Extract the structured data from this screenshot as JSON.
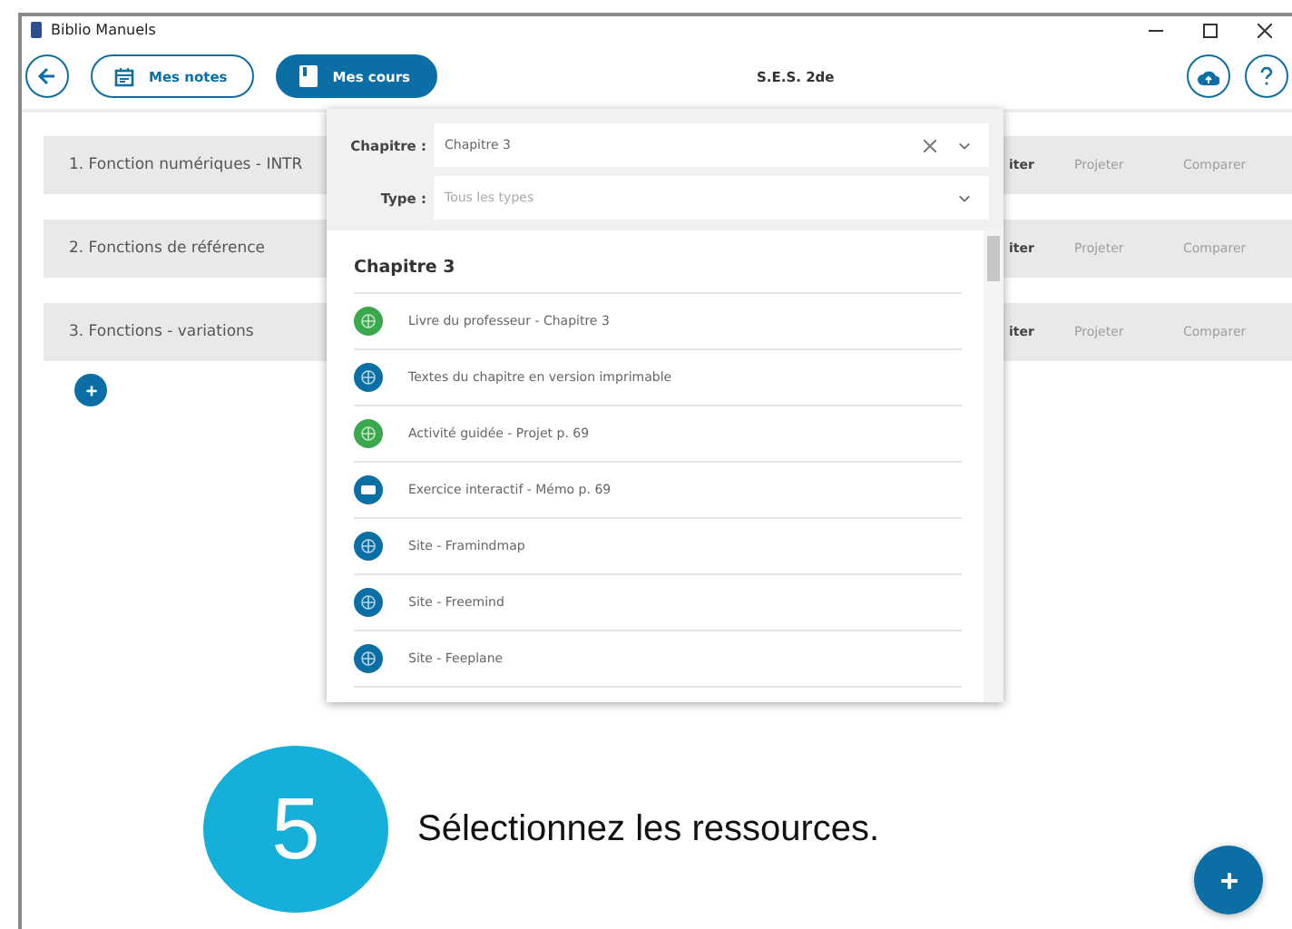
{
  "window": {
    "title": "Biblio Manuels"
  },
  "toolbar": {
    "tabs": [
      {
        "label": "Mes notes",
        "selected": false,
        "kind": "calendar"
      },
      {
        "label": "Mes cours",
        "selected": true,
        "kind": "book"
      }
    ],
    "title": "S.E.S. 2de"
  },
  "rows": [
    {
      "title": "1. Fonction numériques - INTR",
      "actions": [
        {
          "label": "iter",
          "disabled": false
        },
        {
          "label": "Projeter",
          "disabled": true
        },
        {
          "label": "Comparer",
          "disabled": true
        }
      ]
    },
    {
      "title": "2. Fonctions de référence",
      "actions": [
        {
          "label": "iter",
          "disabled": false
        },
        {
          "label": "Projeter",
          "disabled": true
        },
        {
          "label": "Comparer",
          "disabled": true
        }
      ]
    },
    {
      "title": "3. Fonctions - variations",
      "actions": [
        {
          "label": "iter",
          "disabled": false
        },
        {
          "label": "Projeter",
          "disabled": true
        },
        {
          "label": "Comparer",
          "disabled": true
        }
      ]
    }
  ],
  "panel": {
    "filters": [
      {
        "label": "Chapitre :",
        "value": "Chapitre 3",
        "clearable": true
      },
      {
        "label": "Type :",
        "placeholder": "Tous les types",
        "clearable": false
      }
    ],
    "heading": "Chapitre 3",
    "items": [
      {
        "label": "Livre du professeur - Chapitre 3",
        "kind": "globe",
        "color": "#3aa84c"
      },
      {
        "label": "Textes du chapitre en version imprimable",
        "kind": "globe",
        "color": "#0b6fa6"
      },
      {
        "label": "Activité guidée - Projet p. 69",
        "kind": "globe",
        "color": "#3aa84c"
      },
      {
        "label": "Exercice interactif - Mémo p. 69",
        "kind": "screen",
        "color": "#0b6fa6"
      },
      {
        "label": "Site - Framindmap",
        "kind": "globe",
        "color": "#0b6fa6"
      },
      {
        "label": "Site - Freemind",
        "kind": "globe",
        "color": "#0b6fa6"
      },
      {
        "label": "Site - Feeplane",
        "kind": "globe",
        "color": "#0b6fa6"
      }
    ]
  },
  "callout": {
    "number": "5",
    "text": "Sélectionnez les ressources."
  }
}
